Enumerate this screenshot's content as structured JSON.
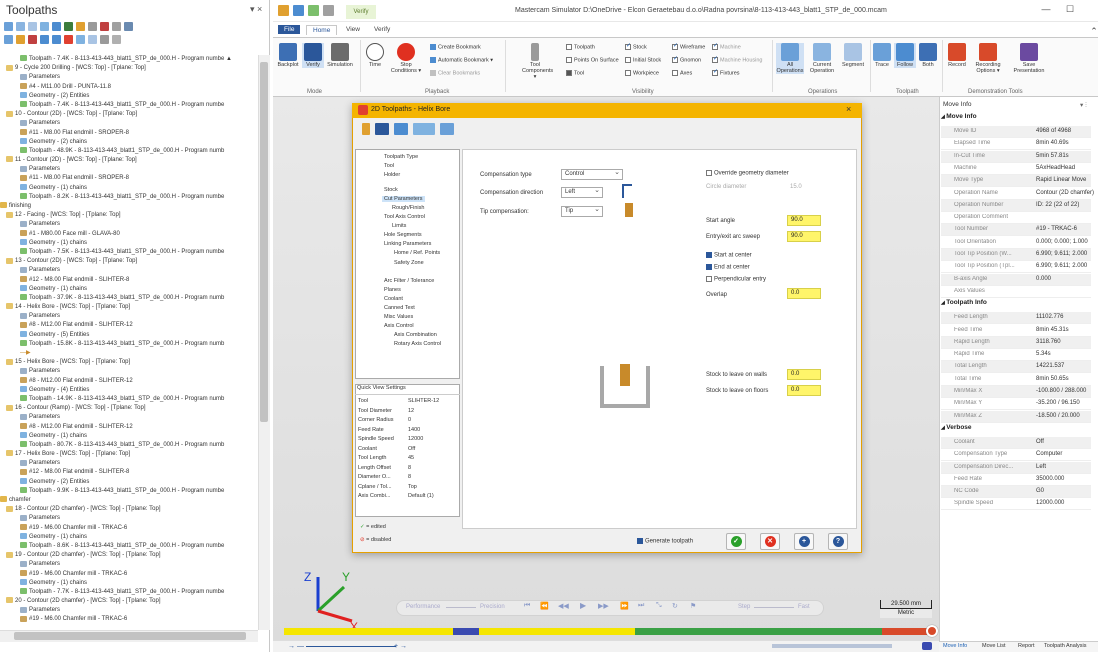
{
  "toolpaths_panel": {
    "title": "Toolpaths",
    "controls": "▾ ×",
    "tree": [
      {
        "indent": 20,
        "icon": "path",
        "text": "Toolpath - 7.4K - 8-113-413-443_blatt1_STP_de_000.H - Program numbe ▲"
      },
      {
        "indent": 6,
        "icon": "folder",
        "text": "9 - Cycle 200 Drilling - [WCS: Top] - [Tplane: Top]"
      },
      {
        "indent": 20,
        "icon": "params",
        "text": "Parameters"
      },
      {
        "indent": 20,
        "icon": "tool",
        "text": "#4 - M11.00 Drill - PUNTA-11.8"
      },
      {
        "indent": 20,
        "icon": "geom",
        "text": "Geometry - (2) Entities"
      },
      {
        "indent": 20,
        "icon": "path",
        "text": "Toolpath - 7.4K - 8-113-413-443_blatt1_STP_de_000.H - Program numbe"
      },
      {
        "indent": 6,
        "icon": "folder",
        "text": "10 - Contour (2D) - [WCS: Top] - [Tplane: Top]"
      },
      {
        "indent": 20,
        "icon": "params",
        "text": "Parameters"
      },
      {
        "indent": 20,
        "icon": "tool",
        "text": "#11 - M8.00 Flat endmill - SROPER-8"
      },
      {
        "indent": 20,
        "icon": "geom",
        "text": "Geometry - (2) chains"
      },
      {
        "indent": 20,
        "icon": "path",
        "text": "Toolpath - 48.9K - 8-113-413-443_blatt1_STP_de_000.H - Program numb"
      },
      {
        "indent": 6,
        "icon": "folder",
        "text": "11 - Contour (2D) - [WCS: Top] - [Tplane: Top]"
      },
      {
        "indent": 20,
        "icon": "params",
        "text": "Parameters"
      },
      {
        "indent": 20,
        "icon": "tool",
        "text": "#11 - M8.00 Flat endmill - SROPER-8"
      },
      {
        "indent": 20,
        "icon": "geom",
        "text": "Geometry - (1) chains"
      },
      {
        "indent": 20,
        "icon": "path",
        "text": "Toolpath - 8.2K - 8-113-413-443_blatt1_STP_de_000.H - Program numbe"
      },
      {
        "indent": 0,
        "icon": "group",
        "text": "finishing"
      },
      {
        "indent": 6,
        "icon": "folder",
        "text": "12 - Facing - [WCS: Top] - [Tplane: Top]"
      },
      {
        "indent": 20,
        "icon": "params",
        "text": "Parameters"
      },
      {
        "indent": 20,
        "icon": "tool",
        "text": "#1 - M80.00 Face mill - GLAVA-80"
      },
      {
        "indent": 20,
        "icon": "geom",
        "text": "Geometry - (1) chains"
      },
      {
        "indent": 20,
        "icon": "path",
        "text": "Toolpath - 7.5K - 8-113-413-443_blatt1_STP_de_000.H - Program numbe"
      },
      {
        "indent": 6,
        "icon": "folder",
        "text": "13 - Contour (2D) - [WCS: Top] - [Tplane: Top]"
      },
      {
        "indent": 20,
        "icon": "params",
        "text": "Parameters"
      },
      {
        "indent": 20,
        "icon": "tool",
        "text": "#12 - M8.00 Flat endmill - SLIHTER-8"
      },
      {
        "indent": 20,
        "icon": "geom",
        "text": "Geometry - (1) chains"
      },
      {
        "indent": 20,
        "icon": "path",
        "text": "Toolpath - 37.9K - 8-113-413-443_blatt1_STP_de_000.H - Program numb"
      },
      {
        "indent": 6,
        "icon": "folder",
        "text": "14 - Helix Bore - [WCS: Top] - [Tplane: Top]"
      },
      {
        "indent": 20,
        "icon": "params",
        "text": "Parameters"
      },
      {
        "indent": 20,
        "icon": "tool",
        "text": "#8 - M12.00 Flat endmill - SLIHTER-12"
      },
      {
        "indent": 20,
        "icon": "geom",
        "text": "Geometry - (5) Entities"
      },
      {
        "indent": 20,
        "icon": "path",
        "text": "Toolpath - 15.8K - 8-113-413-443_blatt1_STP_de_000.H - Program numb"
      },
      {
        "indent": 20,
        "icon": "arrow",
        "text": "—▶"
      },
      {
        "indent": 6,
        "icon": "folder",
        "text": "15 - Helix Bore - [WCS: Top] - [Tplane: Top]"
      },
      {
        "indent": 20,
        "icon": "params",
        "text": "Parameters"
      },
      {
        "indent": 20,
        "icon": "tool",
        "text": "#8 - M12.00 Flat endmill - SLIHTER-12"
      },
      {
        "indent": 20,
        "icon": "geom",
        "text": "Geometry - (4) Entities"
      },
      {
        "indent": 20,
        "icon": "path",
        "text": "Toolpath - 14.9K - 8-113-413-443_blatt1_STP_de_000.H - Program numb"
      },
      {
        "indent": 6,
        "icon": "folder",
        "text": "16 - Contour (Ramp) - [WCS: Top] - [Tplane: Top]"
      },
      {
        "indent": 20,
        "icon": "params",
        "text": "Parameters"
      },
      {
        "indent": 20,
        "icon": "tool",
        "text": "#8 - M12.00 Flat endmill - SLIHTER-12"
      },
      {
        "indent": 20,
        "icon": "geom",
        "text": "Geometry - (1) chains"
      },
      {
        "indent": 20,
        "icon": "path",
        "text": "Toolpath - 80.7K - 8-113-413-443_blatt1_STP_de_000.H - Program numb"
      },
      {
        "indent": 6,
        "icon": "folder",
        "text": "17 - Helix Bore - [WCS: Top] - [Tplane: Top]"
      },
      {
        "indent": 20,
        "icon": "params",
        "text": "Parameters"
      },
      {
        "indent": 20,
        "icon": "tool",
        "text": "#12 - M8.00 Flat endmill - SLIHTER-8"
      },
      {
        "indent": 20,
        "icon": "geom",
        "text": "Geometry - (2) Entities"
      },
      {
        "indent": 20,
        "icon": "path",
        "text": "Toolpath - 9.9K - 8-113-413-443_blatt1_STP_de_000.H - Program numbe"
      },
      {
        "indent": 0,
        "icon": "group",
        "text": "chamfer"
      },
      {
        "indent": 6,
        "icon": "folder",
        "text": "18 - Contour (2D chamfer) - [WCS: Top] - [Tplane: Top]"
      },
      {
        "indent": 20,
        "icon": "params",
        "text": "Parameters"
      },
      {
        "indent": 20,
        "icon": "tool",
        "text": "#19 - M6.00 Chamfer mill - TRKAC-6"
      },
      {
        "indent": 20,
        "icon": "geom",
        "text": "Geometry - (1) chains"
      },
      {
        "indent": 20,
        "icon": "path",
        "text": "Toolpath - 8.6K - 8-113-413-443_blatt1_STP_de_000.H - Program numbe"
      },
      {
        "indent": 6,
        "icon": "folder",
        "text": "19 - Contour (2D chamfer) - [WCS: Top] - [Tplane: Top]"
      },
      {
        "indent": 20,
        "icon": "params",
        "text": "Parameters"
      },
      {
        "indent": 20,
        "icon": "tool",
        "text": "#19 - M6.00 Chamfer mill - TRKAC-6"
      },
      {
        "indent": 20,
        "icon": "geom",
        "text": "Geometry - (1) chains"
      },
      {
        "indent": 20,
        "icon": "path",
        "text": "Toolpath - 7.7K - 8-113-413-443_blatt1_STP_de_000.H - Program numbe"
      },
      {
        "indent": 6,
        "icon": "folder",
        "text": "20 - Contour (2D chamfer) - [WCS: Top] - [Tplane: Top]"
      },
      {
        "indent": 20,
        "icon": "params",
        "text": "Parameters"
      },
      {
        "indent": 20,
        "icon": "tool",
        "text": "#19 - M6.00 Chamfer mill - TRKAC-6"
      }
    ]
  },
  "simulator": {
    "title": "Mastercam Simulator  D:\\OneDrive - Elcon Geraetebau d.o.o\\Radna povrsina\\8-113-413-443_blatt1_STP_de_000.mcam",
    "tabs": [
      "File",
      "Home",
      "View",
      "Verify"
    ],
    "context_tab": "Verify",
    "ribbon": {
      "mode": {
        "label": "Mode",
        "buttons": [
          "Backplot",
          "Verify",
          "Simulation"
        ]
      },
      "playback": {
        "label": "Playback",
        "buttons": [
          "Time",
          "Stop Conditions ▾"
        ],
        "options": [
          "Create Bookmark",
          "Automatic Bookmark ▾",
          "Clear Bookmarks"
        ]
      },
      "visibility": {
        "label": "Visibility",
        "buttons": [
          "Tool",
          "Components ▾"
        ],
        "col1": [
          "Toolpath",
          "Points On Surface",
          "Tool"
        ],
        "col2": [
          "Stock",
          "Initial Stock",
          "Workpiece"
        ],
        "col3": [
          "Wireframe",
          "Gnomon",
          "Axes"
        ],
        "col4": [
          "Machine",
          "Machine Housing",
          "Fixtures"
        ]
      },
      "operations": {
        "label": "Operations",
        "buttons": [
          "All Operations",
          "Current Operation",
          "Segment"
        ]
      },
      "toolpath": {
        "label": "Toolpath",
        "buttons": [
          "Trace",
          "Follow",
          "Both"
        ]
      },
      "demo": {
        "label": "Demonstration Tools",
        "buttons": [
          "Record",
          "Recording Options ▾",
          "Save Presentation"
        ]
      }
    }
  },
  "dialog": {
    "title": "2D Toolpaths - Helix Bore",
    "close": "×",
    "tree": [
      "Toolpath Type",
      "Tool",
      "Holder",
      "Stock",
      "Cut Parameters",
      "Rough/Finish",
      "Tool Axis Control",
      "Limits",
      "Hole Segments",
      "Linking Parameters",
      "Home / Ref. Points",
      "Safety Zone",
      "Arc Filter / Tolerance",
      "Planes",
      "Coolant",
      "Canned Text",
      "Misc Values",
      "Axis Control",
      "Axis Combination",
      "Rotary Axis Control"
    ],
    "fields": {
      "comp_type_label": "Compensation type",
      "comp_type_value": "Control",
      "comp_dir_label": "Compensation direction",
      "comp_dir_value": "Left",
      "tip_comp_label": "Tip compensation:",
      "tip_comp_value": "Tip",
      "override_label": "Override geometry diameter",
      "circle_diam_label": "Circle diameter",
      "circle_diam_value": "15.0",
      "start_angle_label": "Start angle",
      "start_angle_value": "90.0",
      "entry_exit_label": "Entry/exit arc sweep",
      "entry_exit_value": "90.0",
      "start_center_label": "Start at center",
      "end_center_label": "End at center",
      "perp_entry_label": "Perpendicular entry",
      "overlap_label": "Overlap",
      "overlap_value": "0.0",
      "stock_walls_label": "Stock to leave on walls",
      "stock_walls_value": "0.0",
      "stock_floors_label": "Stock to leave on floors",
      "stock_floors_value": "0.0",
      "generate_label": "Generate toolpath"
    },
    "quick_view": {
      "title": "Quick View Settings",
      "rows": [
        [
          "Tool",
          "SLIHTER-12"
        ],
        [
          "Tool Diameter",
          "12"
        ],
        [
          "Corner Radius",
          "0"
        ],
        [
          "Feed Rate",
          "1400"
        ],
        [
          "Spindle Speed",
          "12000"
        ],
        [
          "Coolant",
          "Off"
        ],
        [
          "Tool Length",
          "45"
        ],
        [
          "Length Offset",
          "8"
        ],
        [
          "Diameter O...",
          "8"
        ],
        [
          "Cplane / Tol...",
          "Top"
        ],
        [
          "Axis Combi...",
          "Default (1)"
        ]
      ]
    },
    "legend": {
      "edited": "= edited",
      "disabled": "= disabled"
    }
  },
  "playback_bar": {
    "labels": [
      "Performance",
      "Precision",
      "Step",
      "Fast"
    ],
    "scale_value": "29.500 mm",
    "scale_unit": "Metric"
  },
  "move_info": {
    "title": "Move Info",
    "controls": "▾ ⫶",
    "sections": [
      {
        "name": "Move Info",
        "rows": [
          [
            "Move ID",
            "4968 of 4968"
          ],
          [
            "Elapsed Time",
            "8min 40.69s"
          ],
          [
            "In-Cut Time",
            "5min 57.81s"
          ],
          [
            "Machine",
            "5AxHeadHead"
          ],
          [
            "Move Type",
            "Rapid Linear Move"
          ],
          [
            "Operation Name",
            "Contour (2D chamfer)"
          ],
          [
            "Operation Number",
            "ID: 22 (22 of 22)"
          ],
          [
            "Operation Comment",
            ""
          ],
          [
            "Tool Number",
            "#19 - TRKAC-6"
          ],
          [
            "Tool Orientation",
            "0.000; 0.000; 1.000"
          ],
          [
            "Tool Tip Position (W...",
            "6.990; 9.611; 2.000"
          ],
          [
            "Tool Tip Position (Tpl...",
            "6.990; 9.611; 2.000"
          ],
          [
            "B-axis Angle",
            "0.000"
          ],
          [
            "Axis Values",
            ""
          ]
        ]
      },
      {
        "name": "Toolpath Info",
        "rows": [
          [
            "Feed Length",
            "11102.776"
          ],
          [
            "Feed Time",
            "8min 45.31s"
          ],
          [
            "Rapid Length",
            "3118.760"
          ],
          [
            "Rapid Time",
            "5.34s"
          ],
          [
            "Total Length",
            "14221.537"
          ],
          [
            "Total Time",
            "8min 50.65s"
          ],
          [
            "Min/Max X",
            "-100.800 / 288.000"
          ],
          [
            "Min/Max Y",
            "-35.200 / 96.150"
          ],
          [
            "Min/Max Z",
            "-18.500 / 20.000"
          ]
        ]
      },
      {
        "name": "Verbose",
        "rows": [
          [
            "Coolant",
            "Off"
          ],
          [
            "Compensation Type",
            "Computer"
          ],
          [
            "Compensation Direc...",
            "Left"
          ],
          [
            "Feed Rate",
            "35000.000"
          ],
          [
            "NC Code",
            "G0"
          ],
          [
            "Spindle Speed",
            "12000.000"
          ]
        ]
      }
    ],
    "tabs": [
      "Move Info",
      "Move List",
      "Report",
      "Toolpath Analysis"
    ]
  },
  "gnomon": {
    "x": "X",
    "y": "Y",
    "z": "Z"
  },
  "colors": {
    "accent": "#2b579a",
    "dialog_title": "#f4b400",
    "highlight_field": "#fff56a"
  }
}
